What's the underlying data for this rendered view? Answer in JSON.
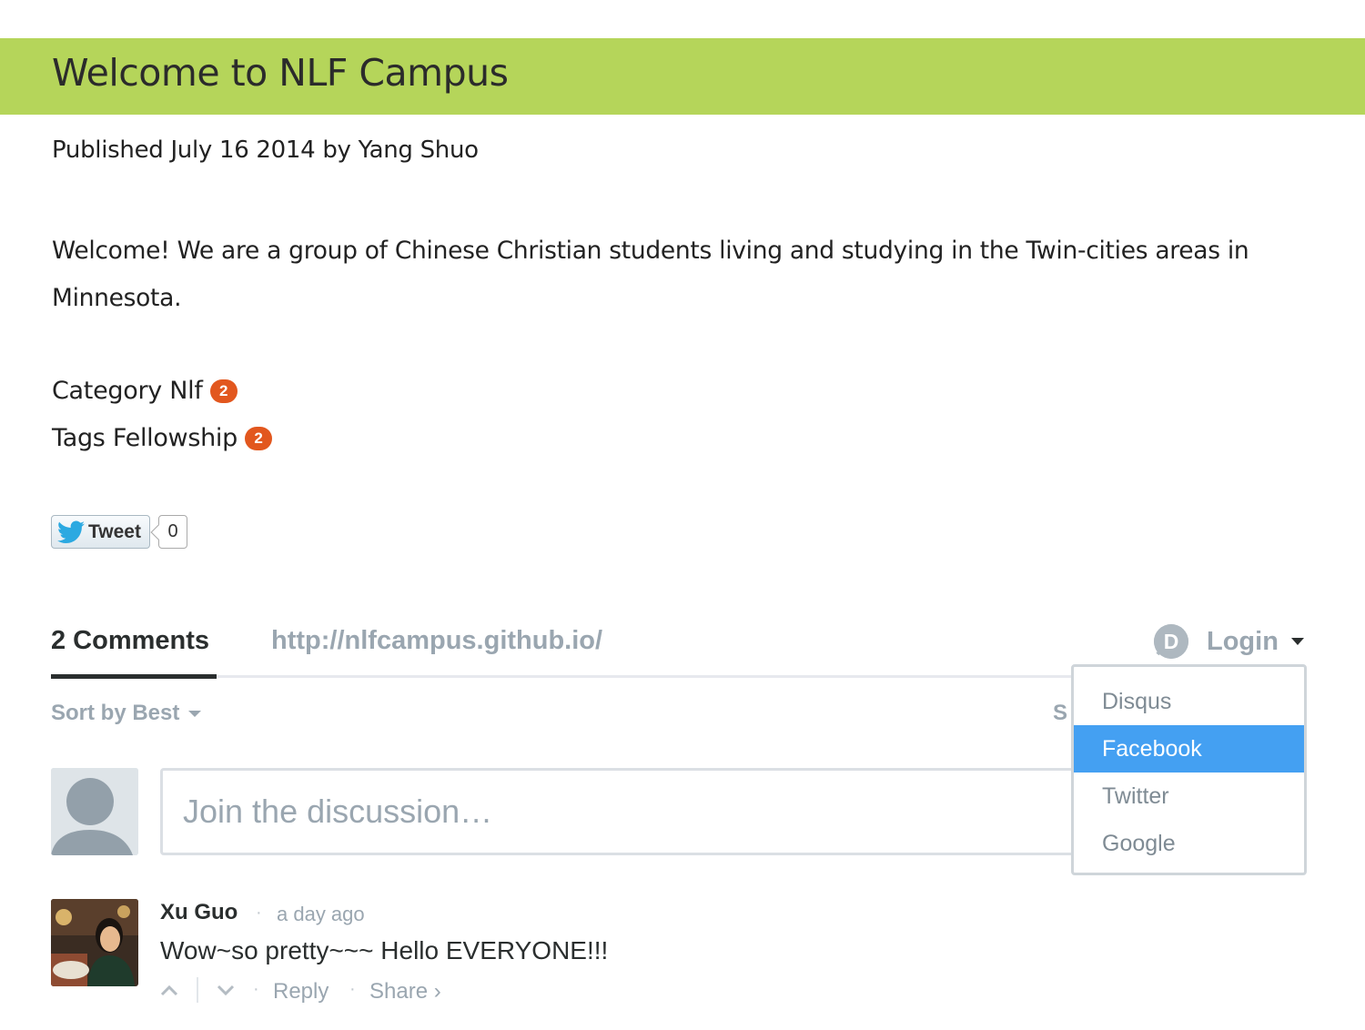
{
  "header": {
    "title": "Welcome to NLF Campus"
  },
  "post": {
    "meta": "Published July 16 2014 by Yang Shuo",
    "body": "Welcome! We are a group of Chinese Christian students living and studying in the Twin-cities areas in Minnesota.",
    "category_label": "Category",
    "category_name": "Nlf",
    "category_count": "2",
    "tags_label": "Tags",
    "tag_name": "Fellowship",
    "tag_count": "2"
  },
  "tweet": {
    "label": "Tweet",
    "count": "0"
  },
  "comments": {
    "count_label": "2 Comments",
    "site_url": "http://nlfcampus.github.io/",
    "login_label": "Login",
    "sort_label": "Sort by Best",
    "share_partial": "S",
    "input_placeholder": "Join the discussion…"
  },
  "login_menu": {
    "items": [
      {
        "label": "Disqus",
        "active": false
      },
      {
        "label": "Facebook",
        "active": true
      },
      {
        "label": "Twitter",
        "active": false
      },
      {
        "label": "Google",
        "active": false
      }
    ]
  },
  "comment": {
    "author": "Xu Guo",
    "time": "a day ago",
    "body": "Wow~so pretty~~~ Hello EVERYONE!!!",
    "reply_label": "Reply",
    "share_label": "Share ›"
  },
  "colors": {
    "banner": "#b5d55a",
    "badge": "#e2571e",
    "menu_active": "#44a0f2",
    "muted": "#9aa6b0"
  }
}
